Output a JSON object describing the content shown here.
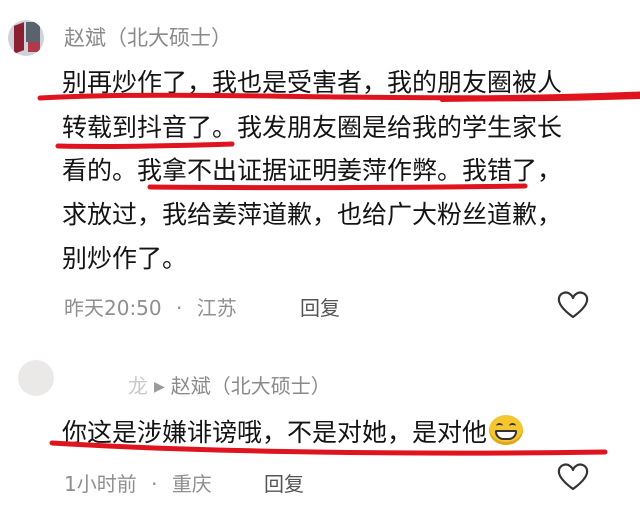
{
  "comments": [
    {
      "author": "赵斌（北大硕士）",
      "lines": [
        "别再炒作了，我也是受害者，我的朋友圈被人",
        "转载到抖音了。我发朋友圈是给我的学生家长",
        "看的。我拿不出证据证明姜萍作弊。我错了，",
        "求放过，我给姜萍道歉，也给广大粉丝道歉，",
        "别炒作了。"
      ],
      "time": "昨天20:50",
      "separator": "·",
      "location": "江苏",
      "reply_label": "回复",
      "like_icon": "heart-outline-icon"
    },
    {
      "author_faded": "龙",
      "reply_arrow": "▶",
      "reply_to": "赵斌（北大硕士）",
      "text": "你这是涉嫌诽谤哦，不是对她，是对他",
      "emoji": "grinning-face-icon",
      "time": "1小时前",
      "separator": "·",
      "location": "重庆",
      "reply_label": "回复",
      "like_icon": "heart-outline-icon"
    }
  ],
  "colors": {
    "underline": "#e0141e",
    "meta_text": "#8f8f8f",
    "body_text": "#141414"
  }
}
